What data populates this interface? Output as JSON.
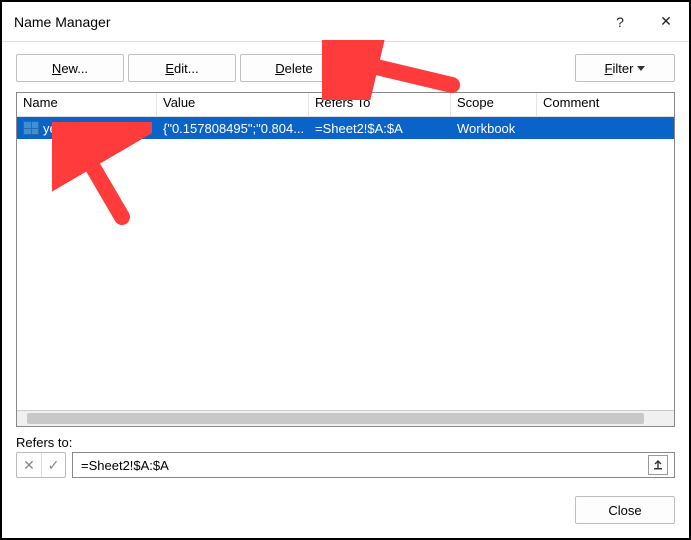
{
  "title": "Name Manager",
  "toolbar": {
    "new_label": "New...",
    "edit_label": "Edit...",
    "delete_label": "Delete",
    "filter_label": "Filter"
  },
  "columns": {
    "name": "Name",
    "value": "Value",
    "refers": "Refers To",
    "scope": "Scope",
    "comment": "Comment"
  },
  "rows": [
    {
      "name": "yeeees",
      "value": "{\"0.157808495\";\"0.804...",
      "refers": "=Sheet2!$A:$A",
      "scope": "Workbook",
      "comment": ""
    }
  ],
  "refers_section": {
    "label": "Refers to:",
    "value": "=Sheet2!$A:$A"
  },
  "footer": {
    "close_label": "Close"
  },
  "titlebar": {
    "help": "?",
    "close": "✕"
  },
  "annotations": {
    "arrow_color": "#ff3b3b"
  }
}
